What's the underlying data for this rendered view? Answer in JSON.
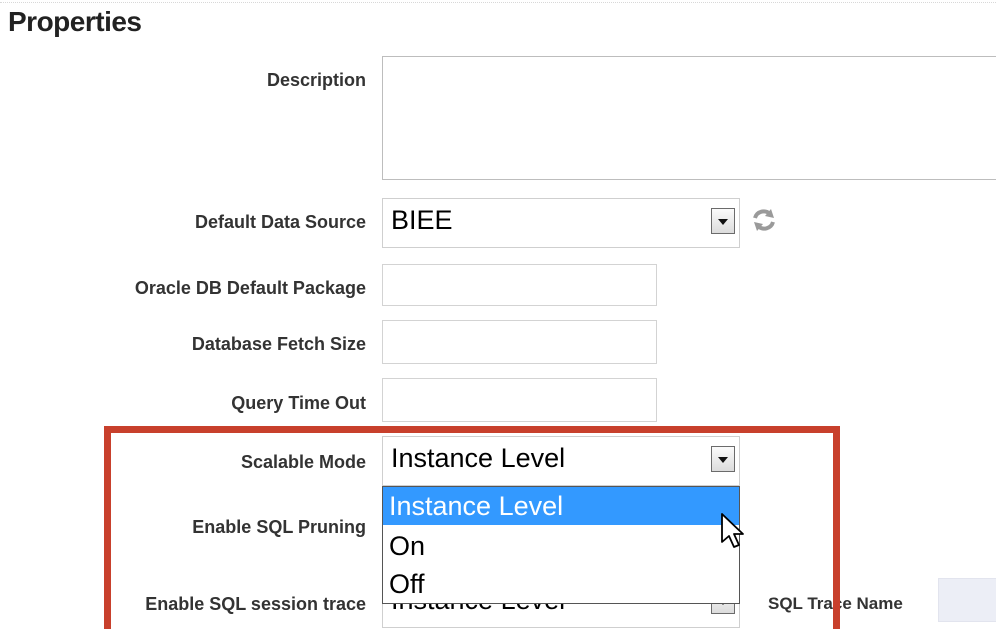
{
  "section": {
    "title": "Properties"
  },
  "fields": {
    "description": {
      "label": "Description",
      "value": ""
    },
    "default_data_source": {
      "label": "Default Data Source",
      "value": "BIEE"
    },
    "oracle_db_default_package": {
      "label": "Oracle DB Default Package",
      "value": ""
    },
    "database_fetch_size": {
      "label": "Database Fetch Size",
      "value": ""
    },
    "query_time_out": {
      "label": "Query Time Out",
      "value": ""
    },
    "scalable_mode": {
      "label": "Scalable Mode",
      "value": "Instance Level"
    },
    "enable_sql_pruning": {
      "label": "Enable SQL Pruning"
    },
    "enable_sql_session_trace": {
      "label": "Enable SQL session trace",
      "value": "Instance Level"
    },
    "sql_trace_name": {
      "label": "SQL Trace Name",
      "value": ""
    }
  },
  "dropdown": {
    "options": [
      "Instance Level",
      "On",
      "Off"
    ],
    "selected_index": 0
  },
  "icons": {
    "refresh": "refresh-icon",
    "dropdown_arrow": "chevron-down-icon",
    "cursor": "cursor-icon"
  },
  "colors": {
    "highlight_border": "#c8402c",
    "selected_option_bg": "#3399ff"
  }
}
